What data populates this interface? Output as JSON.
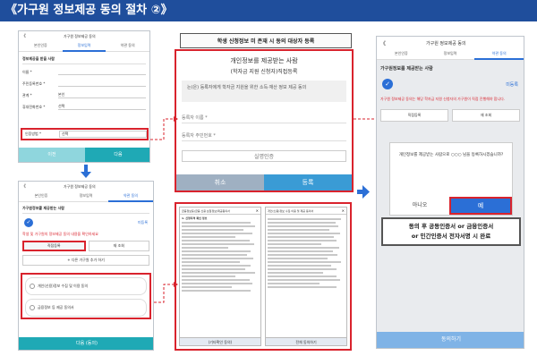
{
  "header": {
    "title": "《가구원 정보제공 동의 절차 ②》"
  },
  "phone1": {
    "back": "《",
    "title": "가구원 정보제공 동의",
    "tabs": [
      "본인인증",
      "정보입력",
      "약관 동의"
    ],
    "section": "정보제공을 받을 사람",
    "rows": [
      {
        "label": "이름 *",
        "value": ""
      },
      {
        "label": "주민등록번호 *",
        "value": ""
      },
      {
        "label": "관계 *",
        "value": "본인"
      },
      {
        "label": "휴대전화번호 *",
        "value": "선택"
      },
      {
        "label": "인증방법 *",
        "value": "선택"
      }
    ],
    "prev": "이전",
    "next": "다음"
  },
  "phone2": {
    "back": "《",
    "title": "가구원 정보제공 동의",
    "tabs": [
      "본인인증",
      "정보입력",
      "약관 동의"
    ],
    "section": "가구원정보를 제공받는 사람",
    "note": "학생 및 가구원의 정보제공 동의 내용을 확인하세요",
    "check_label": "미등록",
    "buttons": [
      "직접등록",
      "재 조회"
    ],
    "add": "+ 다른 가구원 추가 하기",
    "consent1": "개인(신용)정보 수집 및 이용 동의",
    "consent2": "금융정보 등 제공 동의서",
    "agree_button": "다음 (동의)"
  },
  "dialog": {
    "caption": "학생 신청정보 미 존재 시 동의 대상자 등록",
    "title": "개인정보를 제공받는 사람",
    "subtitle": "(학자금 지원 신청자)직접등록",
    "desc": "는(은) 등록자에게 학자금 지원을 위한 소득·재산 정보 제공 동의",
    "name_label": "등록자 이름 *",
    "rrn_label": "등록자 주민번호 *",
    "verify": "실명인증",
    "cancel": "취소",
    "register": "등록"
  },
  "docs": {
    "left_title": "금융정보등(금융·신용·보험정보)제공동의서",
    "right_title": "개인(신용)정보 수집·이용 및 제공 동의서",
    "left_heading": "1. 신청자격 확인 정보",
    "left_btn": "(기타확인 동의)",
    "right_btn": "전체 동의하기",
    "close": "✕"
  },
  "phone3": {
    "back": "《",
    "title": "가구원 정보제공 동의",
    "tabs": [
      "본인인증",
      "정보입력",
      "약관 동의"
    ],
    "section": "가구원정보를 제공받는 사람",
    "warning": "가구원 정보제공 동의는 해당 학자금 지원 신청자의 가구원이 직접 진행해야 합니다.",
    "check_label": "미등록",
    "buttons": [
      "직접등록",
      "재 조회"
    ],
    "popup_text": "개인정보를 제공받는 사람으로 ○○○ 님을 등록하시겠습니까?",
    "no": "아니오",
    "yes": "예",
    "bottom": "동의하기"
  },
  "callout": {
    "line1": "동의 후 공동인증서 or 금융인증서",
    "line2": "or 민간인증서 전자서명 시 완료"
  }
}
